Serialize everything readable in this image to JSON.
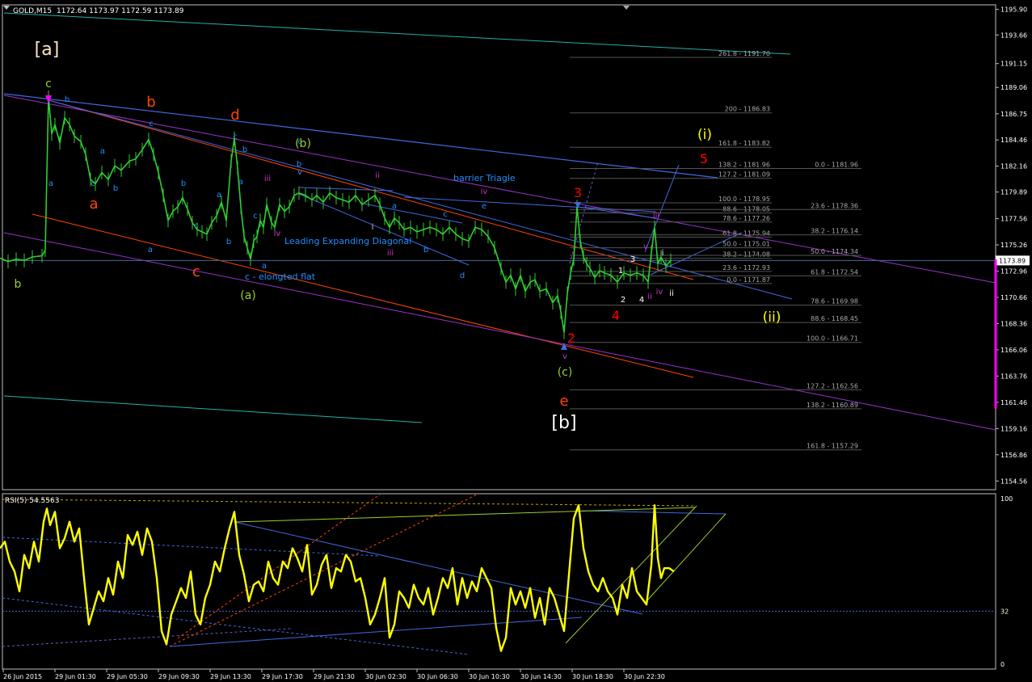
{
  "window": {
    "title": "GOLD,M15",
    "ohlc": "1172.64 1173.97 1172.59 1173.89"
  },
  "current_price": "1173.89",
  "price_axis": {
    "range": [
      1154.0,
      1196.5
    ],
    "ticks": [
      "1195.90",
      "1193.66",
      "1191.15",
      "1189.06",
      "1186.75",
      "1184.46",
      "1182.16",
      "1179.89",
      "1177.56",
      "1175.26",
      "1172.96",
      "1170.66",
      "1168.36",
      "1166.06",
      "1163.76",
      "1161.46",
      "1159.16",
      "1156.86",
      "1154.56"
    ]
  },
  "time_axis": {
    "labels": [
      "26 Jun 2015",
      "29 Jun 01:30",
      "29 Jun 05:30",
      "29 Jun 09:30",
      "29 Jun 13:30",
      "29 Jun 17:30",
      "29 Jun 21:30",
      "30 Jun 02:30",
      "30 Jun 06:30",
      "30 Jun 10:30",
      "30 Jun 14:30",
      "30 Jun 18:30",
      "30 Jun 22:30"
    ]
  },
  "rsi": {
    "label": "RSI(5) 54.5563",
    "levels": [
      "100",
      "32",
      "0"
    ],
    "level_values": [
      100,
      32,
      0
    ]
  },
  "chart_data": {
    "type": "line",
    "symbol": "GOLD",
    "timeframe": "M15",
    "close_path": [
      [
        0,
        1174.1
      ],
      [
        10,
        1173.8
      ],
      [
        20,
        1174.0
      ],
      [
        30,
        1173.9
      ],
      [
        40,
        1174.2
      ],
      [
        52,
        1174.3
      ],
      [
        56,
        1174.8
      ],
      [
        60,
        1188.2
      ],
      [
        64,
        1185.0
      ],
      [
        68,
        1185.8
      ],
      [
        74,
        1184.2
      ],
      [
        80,
        1186.4
      ],
      [
        86,
        1185.8
      ],
      [
        92,
        1184.8
      ],
      [
        100,
        1184.3
      ],
      [
        106,
        1183.2
      ],
      [
        112,
        1181.0
      ],
      [
        118,
        1180.6
      ],
      [
        126,
        1181.6
      ],
      [
        134,
        1181.0
      ],
      [
        142,
        1182.2
      ],
      [
        150,
        1181.8
      ],
      [
        160,
        1182.6
      ],
      [
        168,
        1182.8
      ],
      [
        176,
        1183.6
      ],
      [
        184,
        1184.5
      ],
      [
        190,
        1183.2
      ],
      [
        196,
        1181.6
      ],
      [
        202,
        1179.6
      ],
      [
        208,
        1177.4
      ],
      [
        214,
        1178.2
      ],
      [
        220,
        1178.6
      ],
      [
        226,
        1179.4
      ],
      [
        232,
        1178.4
      ],
      [
        238,
        1177.2
      ],
      [
        244,
        1176.6
      ],
      [
        250,
        1176.4
      ],
      [
        256,
        1176.2
      ],
      [
        262,
        1177.2
      ],
      [
        268,
        1177.8
      ],
      [
        274,
        1179.0
      ],
      [
        280,
        1177.4
      ],
      [
        286,
        1182.6
      ],
      [
        290,
        1184.6
      ],
      [
        294,
        1182.0
      ],
      [
        298,
        1178.6
      ],
      [
        302,
        1176.0
      ],
      [
        306,
        1175.0
      ],
      [
        310,
        1174.0
      ],
      [
        314,
        1175.6
      ],
      [
        318,
        1176.0
      ],
      [
        322,
        1177.4
      ],
      [
        326,
        1176.8
      ],
      [
        330,
        1178.8
      ],
      [
        336,
        1177.2
      ],
      [
        340,
        1176.8
      ],
      [
        346,
        1178.8
      ],
      [
        352,
        1178.2
      ],
      [
        358,
        1178.6
      ],
      [
        364,
        1179.6
      ],
      [
        370,
        1179.8
      ],
      [
        378,
        1179.6
      ],
      [
        386,
        1179.2
      ],
      [
        392,
        1179.6
      ],
      [
        400,
        1179.0
      ],
      [
        408,
        1179.8
      ],
      [
        416,
        1179.4
      ],
      [
        424,
        1179.2
      ],
      [
        432,
        1179.0
      ],
      [
        440,
        1179.6
      ],
      [
        448,
        1178.8
      ],
      [
        456,
        1179.2
      ],
      [
        464,
        1179.6
      ],
      [
        470,
        1178.8
      ],
      [
        476,
        1177.6
      ],
      [
        482,
        1176.8
      ],
      [
        488,
        1177.6
      ],
      [
        494,
        1177.2
      ],
      [
        500,
        1176.6
      ],
      [
        508,
        1176.8
      ],
      [
        516,
        1176.4
      ],
      [
        524,
        1176.6
      ],
      [
        532,
        1176.8
      ],
      [
        540,
        1176.6
      ],
      [
        548,
        1176.2
      ],
      [
        556,
        1176.8
      ],
      [
        564,
        1176.2
      ],
      [
        572,
        1175.8
      ],
      [
        580,
        1175.6
      ],
      [
        588,
        1176.8
      ],
      [
        596,
        1176.6
      ],
      [
        604,
        1176.0
      ],
      [
        612,
        1175.0
      ],
      [
        620,
        1173.2
      ],
      [
        626,
        1172.0
      ],
      [
        632,
        1172.6
      ],
      [
        638,
        1171.4
      ],
      [
        644,
        1172.6
      ],
      [
        650,
        1171.2
      ],
      [
        656,
        1172.0
      ],
      [
        662,
        1172.2
      ],
      [
        668,
        1171.2
      ],
      [
        676,
        1171.4
      ],
      [
        684,
        1170.2
      ],
      [
        690,
        1170.8
      ],
      [
        694,
        1169.4
      ],
      [
        698,
        1167.6
      ],
      [
        702,
        1171.0
      ],
      [
        706,
        1172.8
      ],
      [
        710,
        1174.0
      ],
      [
        714,
        1178.6
      ],
      [
        718,
        1175.6
      ],
      [
        722,
        1174.2
      ],
      [
        726,
        1173.6
      ],
      [
        730,
        1173.2
      ],
      [
        736,
        1172.4
      ],
      [
        742,
        1173.0
      ],
      [
        748,
        1172.8
      ],
      [
        756,
        1172.6
      ],
      [
        764,
        1172.0
      ],
      [
        772,
        1172.8
      ],
      [
        780,
        1172.6
      ],
      [
        788,
        1172.8
      ],
      [
        796,
        1172.6
      ],
      [
        802,
        1172.0
      ],
      [
        806,
        1174.6
      ],
      [
        810,
        1176.8
      ],
      [
        814,
        1173.6
      ],
      [
        818,
        1174.2
      ],
      [
        824,
        1173.4
      ],
      [
        830,
        1173.9
      ]
    ],
    "rsi_path": [
      [
        0,
        70
      ],
      [
        6,
        74
      ],
      [
        12,
        62
      ],
      [
        18,
        56
      ],
      [
        24,
        44
      ],
      [
        30,
        66
      ],
      [
        36,
        58
      ],
      [
        42,
        74
      ],
      [
        48,
        62
      ],
      [
        54,
        86
      ],
      [
        58,
        94
      ],
      [
        62,
        84
      ],
      [
        68,
        92
      ],
      [
        74,
        70
      ],
      [
        80,
        76
      ],
      [
        86,
        86
      ],
      [
        92,
        74
      ],
      [
        98,
        82
      ],
      [
        104,
        52
      ],
      [
        110,
        24
      ],
      [
        116,
        34
      ],
      [
        122,
        44
      ],
      [
        128,
        38
      ],
      [
        134,
        52
      ],
      [
        140,
        42
      ],
      [
        146,
        62
      ],
      [
        152,
        52
      ],
      [
        158,
        78
      ],
      [
        164,
        72
      ],
      [
        170,
        80
      ],
      [
        176,
        66
      ],
      [
        182,
        82
      ],
      [
        188,
        74
      ],
      [
        194,
        52
      ],
      [
        200,
        20
      ],
      [
        206,
        12
      ],
      [
        212,
        30
      ],
      [
        218,
        38
      ],
      [
        224,
        46
      ],
      [
        230,
        40
      ],
      [
        236,
        56
      ],
      [
        242,
        30
      ],
      [
        248,
        24
      ],
      [
        254,
        40
      ],
      [
        260,
        48
      ],
      [
        266,
        62
      ],
      [
        272,
        56
      ],
      [
        278,
        70
      ],
      [
        284,
        82
      ],
      [
        290,
        92
      ],
      [
        296,
        66
      ],
      [
        302,
        54
      ],
      [
        308,
        38
      ],
      [
        314,
        48
      ],
      [
        320,
        50
      ],
      [
        326,
        44
      ],
      [
        332,
        62
      ],
      [
        338,
        52
      ],
      [
        344,
        48
      ],
      [
        350,
        62
      ],
      [
        356,
        58
      ],
      [
        362,
        70
      ],
      [
        368,
        64
      ],
      [
        374,
        56
      ],
      [
        380,
        72
      ],
      [
        386,
        42
      ],
      [
        392,
        48
      ],
      [
        398,
        60
      ],
      [
        404,
        66
      ],
      [
        410,
        46
      ],
      [
        416,
        58
      ],
      [
        422,
        56
      ],
      [
        428,
        66
      ],
      [
        434,
        62
      ],
      [
        440,
        50
      ],
      [
        446,
        52
      ],
      [
        452,
        40
      ],
      [
        458,
        24
      ],
      [
        464,
        30
      ],
      [
        470,
        40
      ],
      [
        476,
        52
      ],
      [
        482,
        16
      ],
      [
        488,
        24
      ],
      [
        494,
        44
      ],
      [
        500,
        40
      ],
      [
        506,
        34
      ],
      [
        512,
        48
      ],
      [
        518,
        40
      ],
      [
        524,
        36
      ],
      [
        530,
        46
      ],
      [
        536,
        30
      ],
      [
        542,
        40
      ],
      [
        548,
        52
      ],
      [
        554,
        46
      ],
      [
        560,
        58
      ],
      [
        566,
        36
      ],
      [
        572,
        52
      ],
      [
        578,
        40
      ],
      [
        584,
        50
      ],
      [
        590,
        44
      ],
      [
        596,
        58
      ],
      [
        602,
        52
      ],
      [
        608,
        46
      ],
      [
        614,
        22
      ],
      [
        620,
        8
      ],
      [
        626,
        16
      ],
      [
        632,
        46
      ],
      [
        638,
        36
      ],
      [
        644,
        44
      ],
      [
        650,
        34
      ],
      [
        656,
        46
      ],
      [
        662,
        28
      ],
      [
        668,
        40
      ],
      [
        674,
        24
      ],
      [
        680,
        46
      ],
      [
        686,
        40
      ],
      [
        692,
        30
      ],
      [
        698,
        20
      ],
      [
        704,
        54
      ],
      [
        710,
        88
      ],
      [
        716,
        96
      ],
      [
        722,
        70
      ],
      [
        728,
        56
      ],
      [
        734,
        48
      ],
      [
        740,
        44
      ],
      [
        746,
        52
      ],
      [
        752,
        44
      ],
      [
        758,
        40
      ],
      [
        764,
        30
      ],
      [
        770,
        48
      ],
      [
        776,
        40
      ],
      [
        782,
        58
      ],
      [
        788,
        44
      ],
      [
        794,
        40
      ],
      [
        800,
        36
      ],
      [
        806,
        60
      ],
      [
        810,
        96
      ],
      [
        814,
        64
      ],
      [
        818,
        52
      ],
      [
        822,
        58
      ],
      [
        828,
        58
      ],
      [
        834,
        56
      ]
    ],
    "fib_levels": [
      {
        "label": "261.8 - 1191.70",
        "value": 1191.7
      },
      {
        "label": "200 - 1186.83",
        "value": 1186.83
      },
      {
        "label": "161.8 - 1183.82",
        "value": 1183.82
      },
      {
        "label": "138.2 - 1181.96",
        "value": 1181.96
      },
      {
        "label": "127.2 - 1181.09",
        "value": 1181.09
      },
      {
        "label": "100.0 - 1178.95",
        "value": 1178.95
      },
      {
        "label": "88.6 - 1178.05",
        "value": 1178.05
      },
      {
        "label": "78.6 - 1177.26",
        "value": 1177.26
      },
      {
        "label": "61.8 - 1175.94",
        "value": 1175.94
      },
      {
        "label": "50.0 - 1175.01",
        "value": 1175.01
      },
      {
        "label": "38.2 - 1174.08",
        "value": 1174.08
      },
      {
        "label": "23.6 - 1172.93",
        "value": 1172.93
      },
      {
        "label": "0.0 - 1171.87",
        "value": 1171.87
      },
      {
        "label": "0.0 - 1181.96",
        "value": 1181.96
      },
      {
        "label": "23.6 - 1178.36",
        "value": 1178.36
      },
      {
        "label": "38.2 - 1176.14",
        "value": 1176.14
      },
      {
        "label": "50.0 - 1174.34",
        "value": 1174.34
      },
      {
        "label": "61.8 - 1172.54",
        "value": 1172.54
      },
      {
        "label": "78.6 - 1169.98",
        "value": 1169.98
      },
      {
        "label": "88.6 - 1168.45",
        "value": 1168.45
      },
      {
        "label": "100.0 - 1166.71",
        "value": 1166.71
      },
      {
        "label": "127.2 - 1162.56",
        "value": 1162.56
      },
      {
        "label": "138.2 - 1160.89",
        "value": 1160.89
      },
      {
        "label": "161.8 - 1157.29",
        "value": 1157.29
      }
    ],
    "wave_labels": [
      {
        "text": "[a]",
        "color": "#ffe4c4"
      },
      {
        "text": "[b]",
        "color": "#ffffff"
      },
      {
        "text": "(a)",
        "color": "#9acd32"
      },
      {
        "text": "(b)",
        "color": "#9acd32"
      },
      {
        "text": "(c)",
        "color": "#9acd32"
      },
      {
        "text": "(i)",
        "color": "#ffff00"
      },
      {
        "text": "(ii)",
        "color": "#ffff00"
      },
      {
        "text": "a",
        "color": "#ff4500"
      },
      {
        "text": "b",
        "color": "#ff4500"
      },
      {
        "text": "c",
        "color": "#ff4500"
      },
      {
        "text": "d",
        "color": "#ff4500"
      },
      {
        "text": "e",
        "color": "#ff4500"
      },
      {
        "text": "2",
        "color": "#ff0000"
      },
      {
        "text": "3",
        "color": "#ff0000"
      },
      {
        "text": "4",
        "color": "#ff0000"
      },
      {
        "text": "5",
        "color": "#ff0000"
      },
      {
        "text": "c",
        "color": "#9acd32"
      },
      {
        "text": "b",
        "color": "#9acd32"
      }
    ],
    "annotations": [
      "Leading Expanding Diagonal",
      "barrier Triagle",
      "c - elongted flat"
    ],
    "small_labels": [
      {
        "text": "b",
        "color": "#1e90ff"
      },
      {
        "text": "a",
        "color": "#1e90ff"
      },
      {
        "text": "c",
        "color": "#1e90ff"
      },
      {
        "text": "a",
        "color": "#1e90ff"
      },
      {
        "text": "b",
        "color": "#1e90ff"
      },
      {
        "text": "c",
        "color": "#1e90ff"
      },
      {
        "text": "a",
        "color": "#1e90ff"
      },
      {
        "text": "b",
        "color": "#1e90ff"
      },
      {
        "text": "c",
        "color": "#1e90ff"
      },
      {
        "text": "a",
        "color": "#1e90ff"
      },
      {
        "text": "b",
        "color": "#1e90ff"
      },
      {
        "text": "c",
        "color": "#1e90ff"
      },
      {
        "text": "a",
        "color": "#1e90ff"
      },
      {
        "text": "b",
        "color": "#1e90ff"
      },
      {
        "text": "c",
        "color": "#1e90ff"
      },
      {
        "text": "a",
        "color": "#1e90ff"
      },
      {
        "text": "b",
        "color": "#1e90ff"
      },
      {
        "text": "c",
        "color": "#1e90ff"
      },
      {
        "text": "d",
        "color": "#1e90ff"
      },
      {
        "text": "e",
        "color": "#1e90ff"
      },
      {
        "text": "a",
        "color": "#1e90ff"
      },
      {
        "text": "b",
        "color": "#1e90ff"
      },
      {
        "text": "c",
        "color": "#1e90ff"
      },
      {
        "text": "v",
        "color": "#1e90ff"
      },
      {
        "text": "iii",
        "color": "#cc33cc"
      },
      {
        "text": "iv",
        "color": "#cc33cc"
      },
      {
        "text": "v",
        "color": "#cc33cc"
      },
      {
        "text": "ii",
        "color": "#cc33cc"
      },
      {
        "text": "iii",
        "color": "#cc33cc"
      },
      {
        "text": "iv",
        "color": "#cc33cc"
      },
      {
        "text": "i",
        "color": "#cccccc"
      },
      {
        "text": "1",
        "color": "#ffffff"
      },
      {
        "text": "2",
        "color": "#ffffff"
      },
      {
        "text": "3",
        "color": "#ffffff"
      },
      {
        "text": "4",
        "color": "#ffffff"
      },
      {
        "text": "iii",
        "color": "#cc33cc"
      },
      {
        "text": "ii",
        "color": "#cc33cc"
      },
      {
        "text": "iv",
        "color": "#cc33cc"
      },
      {
        "text": "i",
        "color": "#ffffff"
      },
      {
        "text": "ii",
        "color": "#ffffff"
      },
      {
        "text": "v",
        "color": "#cc33cc"
      }
    ],
    "colors": {
      "price": "#32cd32",
      "rsi": "#ffff00",
      "grid": "#808080",
      "current_price_line": "#4a6a9a"
    }
  }
}
